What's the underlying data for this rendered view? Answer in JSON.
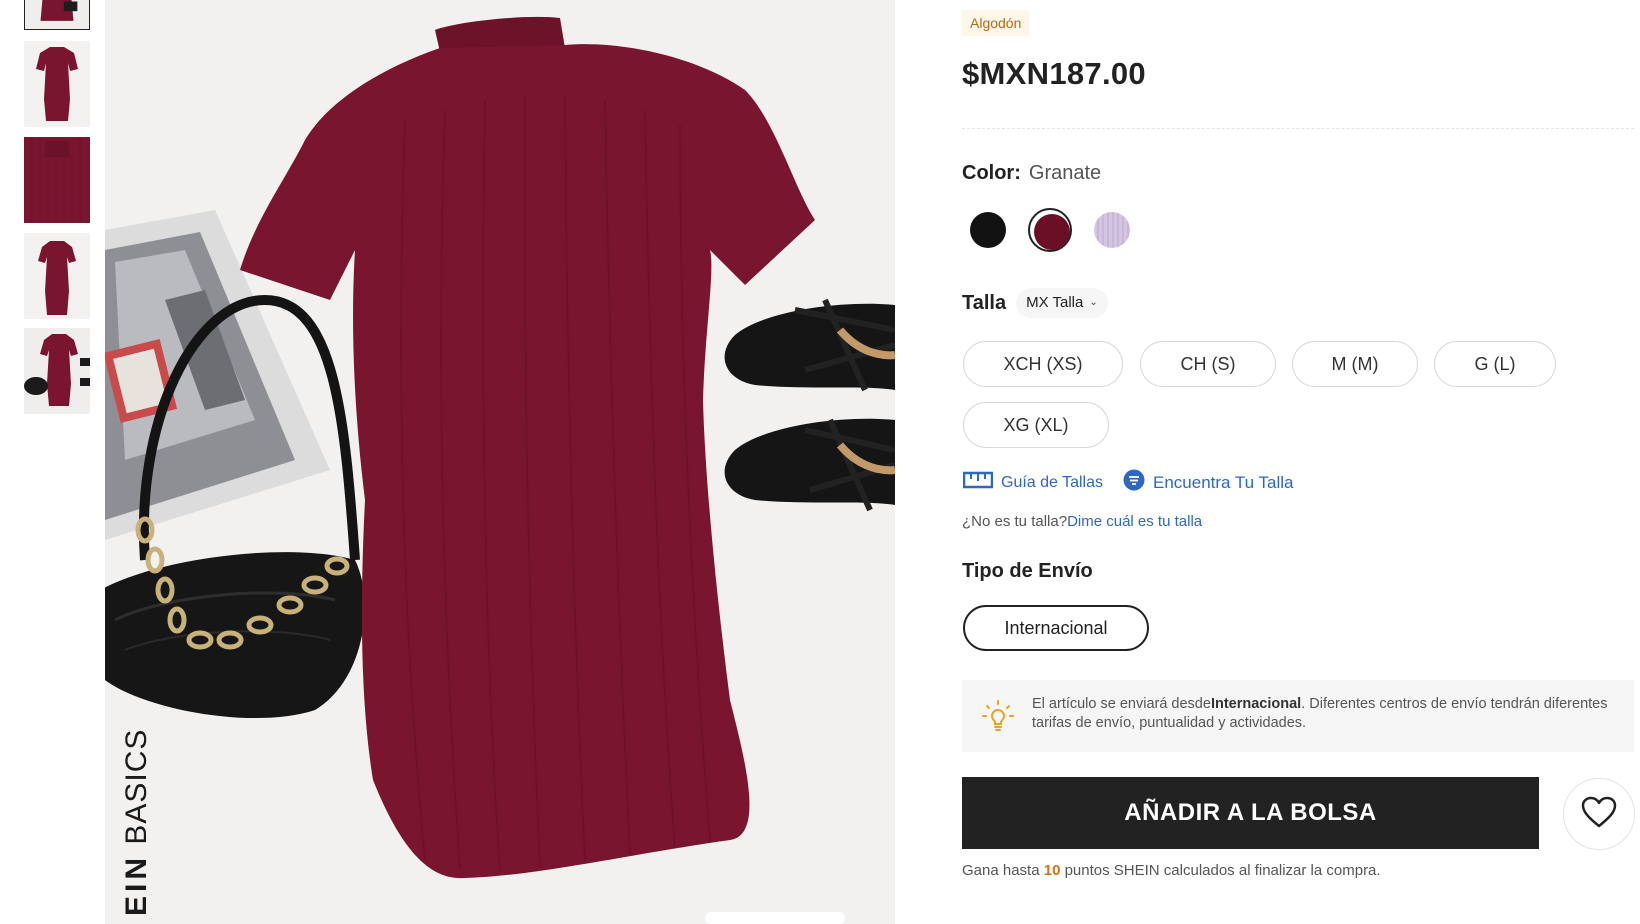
{
  "product": {
    "material_badge": "Algodón",
    "price": "$MXN187.00",
    "brand_watermark_bold": "EIN",
    "brand_watermark_light": "BASICS"
  },
  "color": {
    "label": "Color:",
    "selected": "Granate",
    "swatches": [
      {
        "name": "Negro",
        "hex": "#121212"
      },
      {
        "name": "Granate",
        "hex": "#6b0f26"
      },
      {
        "name": "Lila",
        "hex": "#d4c6e2"
      }
    ]
  },
  "size": {
    "label": "Talla",
    "unit": "MX Talla",
    "options": [
      "XCH (XS)",
      "CH (S)",
      "M (M)",
      "G (L)",
      "XG (XL)"
    ],
    "guide_label": "Guía de Tallas",
    "find_label": "Encuentra Tu Talla",
    "not_your_size": "¿No es tu talla?",
    "tell_us_link": "Dime cuál es tu talla"
  },
  "shipping": {
    "title": "Tipo de Envío",
    "option": "Internacional",
    "notice_prefix": "El artículo se enviará desde",
    "notice_bold": "Internacional",
    "notice_suffix": ". Diferentes centros de envío tendrán diferentes tarifas de envío, puntualidad y actividades."
  },
  "cart": {
    "add_label": "AÑADIR A LA BOLSA",
    "points_prefix": "Gana hasta ",
    "points_value": "10",
    "points_suffix": " puntos SHEIN calculados al finalizar la compra."
  },
  "colors": {
    "dress": "#7a1530",
    "accent_link": "#2d68c4",
    "points_orange": "#d4711a",
    "badge_text": "#b86b12"
  },
  "icons": [
    "ruler-icon",
    "find-size-icon",
    "lightbulb-icon",
    "heart-icon",
    "chevron-down-icon"
  ]
}
